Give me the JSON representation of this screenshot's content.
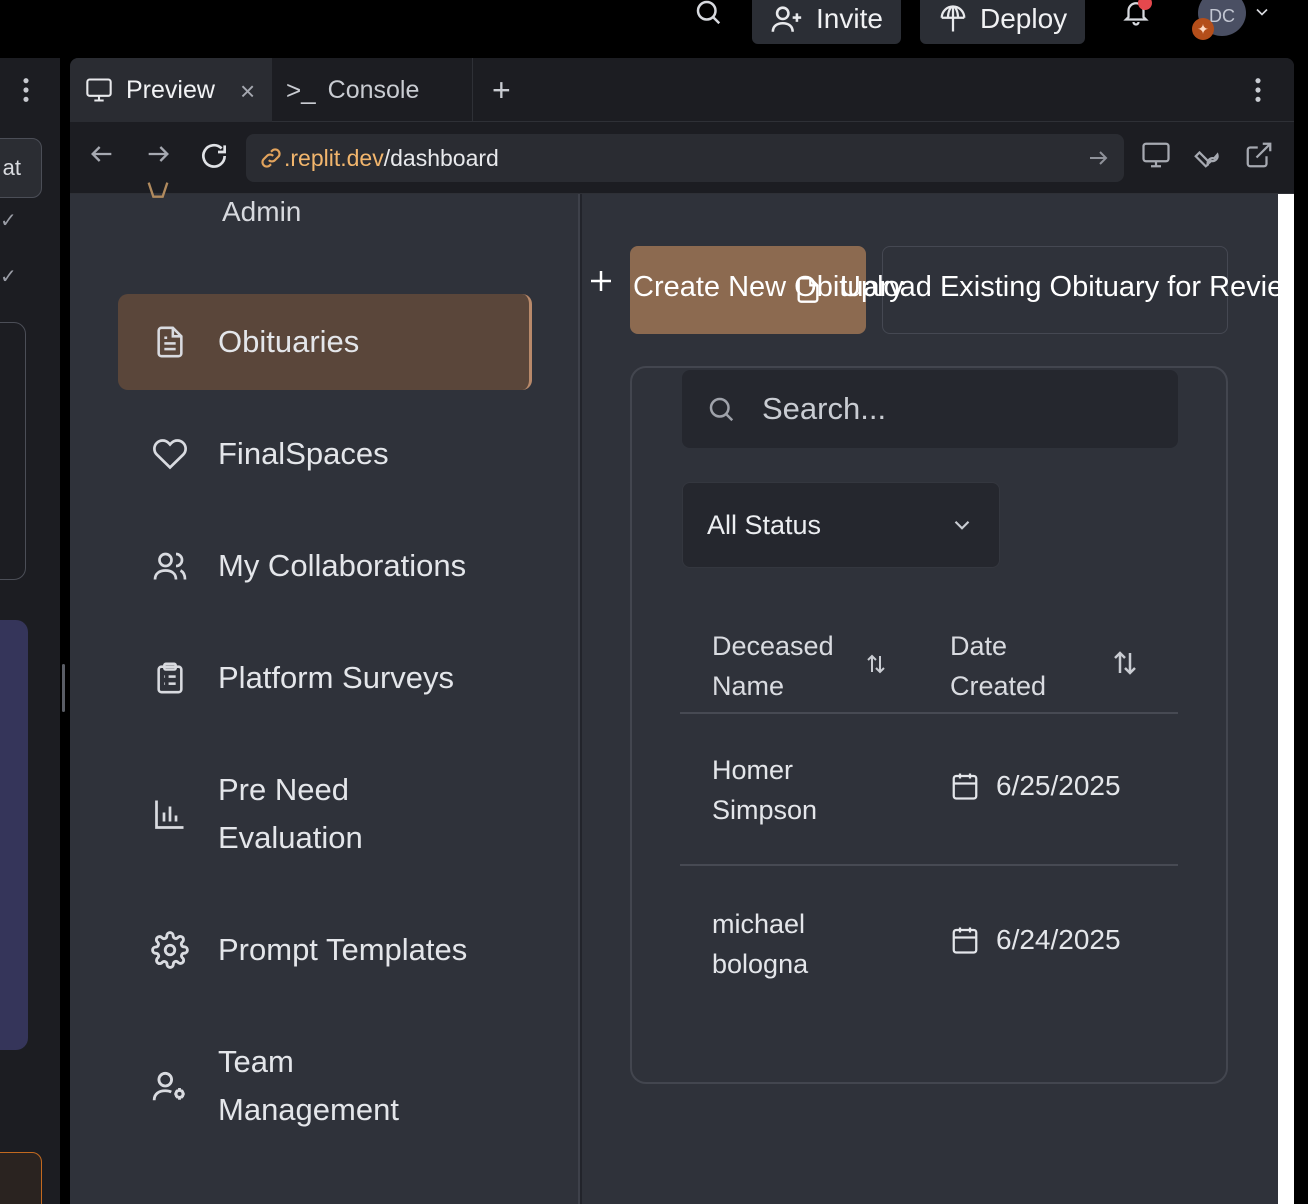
{
  "topbar": {
    "invite_label": "Invite",
    "deploy_label": "Deploy",
    "avatar_initials": "DC"
  },
  "left_strip": {
    "chat_label": "at"
  },
  "tabs": [
    {
      "label": "Preview"
    },
    {
      "label": "Console"
    }
  ],
  "urlbar": {
    "host": ".replit.dev",
    "path": "/dashboard"
  },
  "sidebar": {
    "admin_label": "Admin",
    "items": [
      {
        "label": "Obituaries",
        "icon": "file-text-icon",
        "active": true
      },
      {
        "label": "FinalSpaces",
        "icon": "heart-icon"
      },
      {
        "label": "My Collaborations",
        "icon": "users-icon"
      },
      {
        "label": "Platform Surveys",
        "icon": "clipboard-list-icon"
      },
      {
        "label": "Pre Need Evaluation",
        "icon": "bar-chart-icon"
      },
      {
        "label": "Prompt Templates",
        "icon": "gear-icon"
      },
      {
        "label": "Team Management",
        "icon": "user-cog-icon"
      }
    ]
  },
  "main": {
    "create_label": "Create New Obituary",
    "upload_label": "Upload Existing Obituary for Review",
    "search_placeholder": "Search...",
    "status_filter": "All Status",
    "table": {
      "columns": [
        "Deceased Name",
        "Date Created"
      ],
      "rows": [
        {
          "name": "Homer Simpson",
          "date": "6/25/2025"
        },
        {
          "name": "michael bologna",
          "date": "6/24/2025"
        }
      ]
    }
  },
  "colors": {
    "accent_active": "#5a463a",
    "primary_button": "#8c6a50",
    "sidebar_bg": "#2f323a",
    "notification_dot": "#e5484d"
  }
}
